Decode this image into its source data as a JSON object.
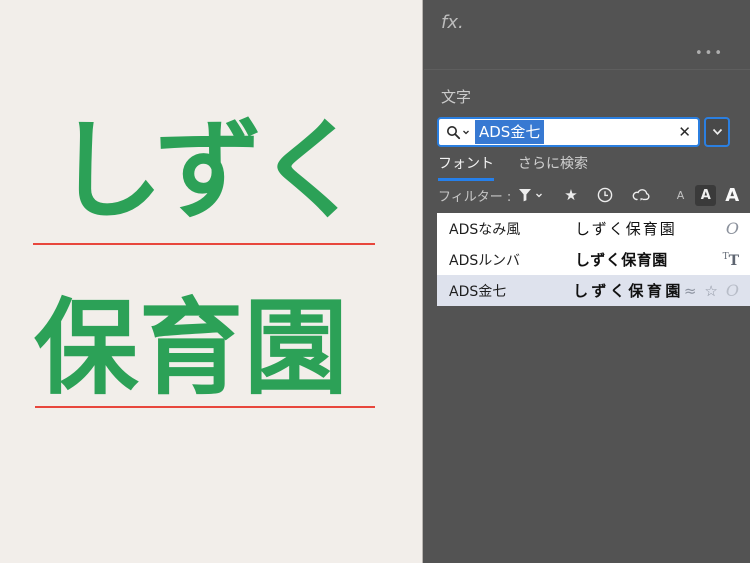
{
  "canvas": {
    "word_top": "しずく",
    "word_bottom": "保育園"
  },
  "panel": {
    "fx_label": "fx.",
    "menu_dots": "•••",
    "title": "文字",
    "search": {
      "value": "ADS金七",
      "clear_icon": "✕"
    },
    "tabs": {
      "fonts": "フォント",
      "find_more": "さらに検索"
    },
    "filter": {
      "label": "フィルター :",
      "star_icon": "★",
      "size_small": "A",
      "size_medium": "A",
      "size_large": "A"
    },
    "font_list": [
      {
        "name": "ADSなみ風",
        "preview": "しずく保育園",
        "selected": false
      },
      {
        "name": "ADSルンバ",
        "preview": "しずく保育園",
        "selected": false
      },
      {
        "name": "ADS金七",
        "preview": "しずく保育園",
        "selected": true
      }
    ],
    "row_icons": {
      "opentype": "O",
      "truetype_t": "T",
      "similar": "≈",
      "favorite": "☆"
    }
  },
  "colors": {
    "accent_blue": "#2680eb",
    "input_border_blue": "#2b7fe0",
    "selection_blue": "#3779d2",
    "canvas_green": "#2ca157",
    "baseline_red": "#e8463c",
    "panel_bg": "#535353",
    "canvas_bg": "#f2eeea",
    "selected_row_bg": "#dee2ed"
  }
}
